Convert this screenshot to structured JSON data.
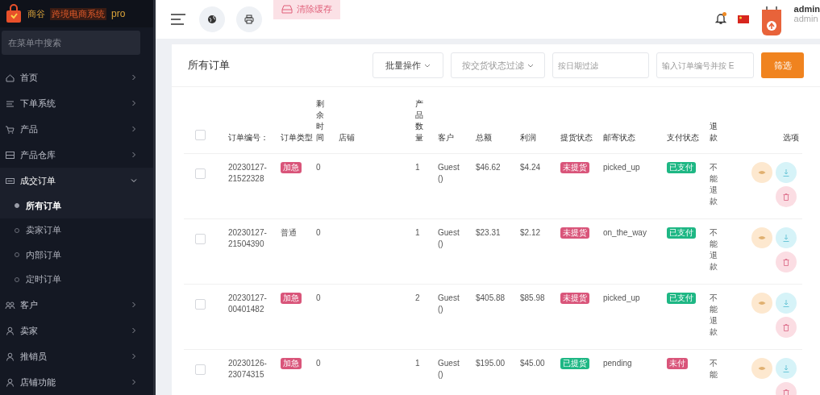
{
  "brand": {
    "name": "商谷",
    "subtitle": "跨境电商系统",
    "edition": "pro"
  },
  "sidebar": {
    "search": {
      "placeholder": "在菜单中搜索"
    },
    "items": [
      {
        "label": "首页",
        "expanded": false
      },
      {
        "label": "下单系统",
        "expanded": false
      },
      {
        "label": "产品",
        "expanded": false
      },
      {
        "label": "产品仓库",
        "expanded": false
      },
      {
        "label": "成交订单",
        "expanded": true,
        "children": [
          {
            "label": "所有订单",
            "selected": true
          },
          {
            "label": "卖家订单",
            "selected": false
          },
          {
            "label": "内部订单",
            "selected": false
          },
          {
            "label": "定时订单",
            "selected": false
          }
        ]
      },
      {
        "label": "客户",
        "expanded": false
      },
      {
        "label": "卖家",
        "expanded": false
      },
      {
        "label": "推销员",
        "expanded": false
      },
      {
        "label": "店铺功能",
        "expanded": false
      }
    ]
  },
  "topbar": {
    "clear_cache": "清除缓存",
    "notification_unread": true,
    "user": {
      "name": "admin",
      "role": "admin"
    }
  },
  "card": {
    "title": "所有订单",
    "bulk_action": "批量操作",
    "status_filter": {
      "placeholder": "按交货状态过滤"
    },
    "date_filter": {
      "placeholder": "按日期过滤"
    },
    "search": {
      "placeholder": "输入订单编号并按 E"
    },
    "filter_button": "筛选"
  },
  "table": {
    "select_all": {
      "checked": false
    },
    "columns": [
      {
        "label": "订单编号："
      },
      {
        "label": "订单类型"
      },
      {
        "label": "剩余时间"
      },
      {
        "label": "店铺"
      },
      {
        "label": "产品数量"
      },
      {
        "label": "客户"
      },
      {
        "label": "总额"
      },
      {
        "label": "利润"
      },
      {
        "label": "提货状态"
      },
      {
        "label": "邮寄状态"
      },
      {
        "label": "支付状态"
      },
      {
        "label": "退款"
      },
      {
        "label": "选项"
      }
    ],
    "rows": [
      {
        "checked": false,
        "order_no": "20230127-21522328",
        "type": {
          "kind": "urgent",
          "label": "加急"
        },
        "remaining": "0",
        "quantity": "1",
        "customer": "Guest ()",
        "total": "$46.62",
        "profit": "$4.24",
        "pickup": {
          "done": false,
          "label": "未提货"
        },
        "shipping": "picked_up",
        "payment": {
          "paid": true,
          "label": "已支付"
        },
        "refund": "不能退款"
      },
      {
        "checked": false,
        "order_no": "20230127-21504390",
        "type": {
          "kind": "normal",
          "label": "普通"
        },
        "remaining": "0",
        "quantity": "1",
        "customer": "Guest ()",
        "total": "$23.31",
        "profit": "$2.12",
        "pickup": {
          "done": false,
          "label": "未提货"
        },
        "shipping": "on_the_way",
        "payment": {
          "paid": true,
          "label": "已支付"
        },
        "refund": "不能退款"
      },
      {
        "checked": false,
        "order_no": "20230127-00401482",
        "type": {
          "kind": "urgent",
          "label": "加急"
        },
        "remaining": "0",
        "quantity": "2",
        "customer": "Guest ()",
        "total": "$405.88",
        "profit": "$85.98",
        "pickup": {
          "done": false,
          "label": "未提货"
        },
        "shipping": "picked_up",
        "payment": {
          "paid": true,
          "label": "已支付"
        },
        "refund": "不能退款"
      },
      {
        "checked": false,
        "order_no": "20230126-23074315",
        "type": {
          "kind": "urgent",
          "label": "加急"
        },
        "remaining": "0",
        "quantity": "1",
        "customer": "Guest ()",
        "total": "$195.00",
        "profit": "$45.00",
        "pickup": {
          "done": true,
          "label": "已提货"
        },
        "shipping": "pending",
        "payment": {
          "paid": false,
          "label": "未付"
        },
        "refund": "不能"
      }
    ]
  }
}
